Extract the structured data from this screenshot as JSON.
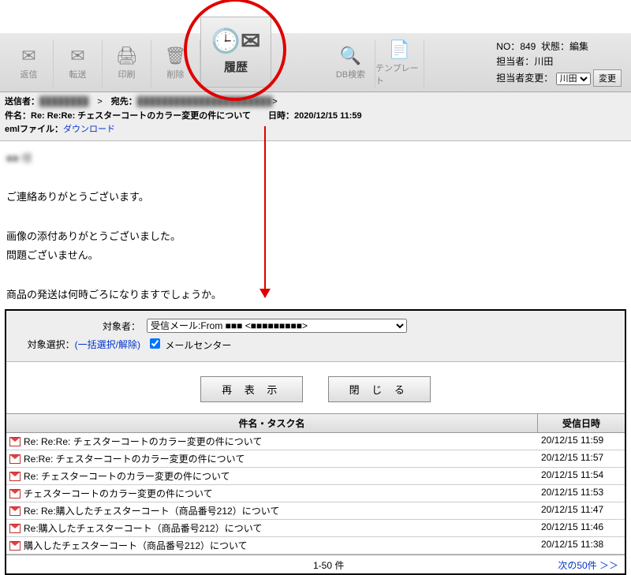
{
  "toolbar": {
    "reply": "返信",
    "forward": "転送",
    "print": "印刷",
    "delete": "削除",
    "history": "履歴",
    "dbsearch": "DB検索",
    "template": "テンプレート"
  },
  "info": {
    "no_label": "NO：",
    "no_value": "849",
    "status_label": "状態：",
    "status_value": "編集",
    "assignee_label": "担当者：",
    "assignee_value": "川田",
    "assignee_change_label": "担当者変更：",
    "assignee_select": "川田",
    "change_btn": "変更"
  },
  "meta": {
    "sender_label": "送信者：",
    "to_label": "宛先：",
    "subject_label": "件名：",
    "subject_value": "Re: Re:Re: チェスターコートのカラー変更の件について",
    "date_label": "日時：",
    "date_value": "2020/12/15 11:59",
    "eml_label": "emlファイル：",
    "eml_link": "ダウンロード"
  },
  "body": {
    "l1": "■■ 様",
    "l2": "ご連絡ありがとうございます。",
    "l3": "画像の添付ありがとうございました。",
    "l4": "問題ございません。",
    "l5": "商品の発送は何時ごろになりますでしょうか。"
  },
  "history": {
    "target_label": "対象者：",
    "target_select": "受信メール:From ■■■  <■■■■■■■■■>",
    "sel_label": "対象選択：",
    "bulk_link": "(一括選択/解除)",
    "mailcenter_label": "メールセンター",
    "redisplay_btn": "再 表 示",
    "close_btn": "閉 じ る",
    "col_subject": "件名・タスク名",
    "col_date": "受信日時",
    "rows": [
      {
        "subject": "Re: Re:Re: チェスターコートのカラー変更の件について",
        "date": "20/12/15 11:59"
      },
      {
        "subject": "Re:Re: チェスターコートのカラー変更の件について",
        "date": "20/12/15 11:57"
      },
      {
        "subject": "Re: チェスターコートのカラー変更の件について",
        "date": "20/12/15 11:54"
      },
      {
        "subject": "チェスターコートのカラー変更の件について",
        "date": "20/12/15 11:53"
      },
      {
        "subject": "Re: Re:購入したチェスターコート（商品番号212）について",
        "date": "20/12/15 11:47"
      },
      {
        "subject": "Re:購入したチェスターコート（商品番号212）について",
        "date": "20/12/15 11:46"
      },
      {
        "subject": "購入したチェスターコート（商品番号212）について",
        "date": "20/12/15 11:38"
      }
    ],
    "foot_count": "1-50 件",
    "foot_next": "次の50件 ＞＞"
  }
}
